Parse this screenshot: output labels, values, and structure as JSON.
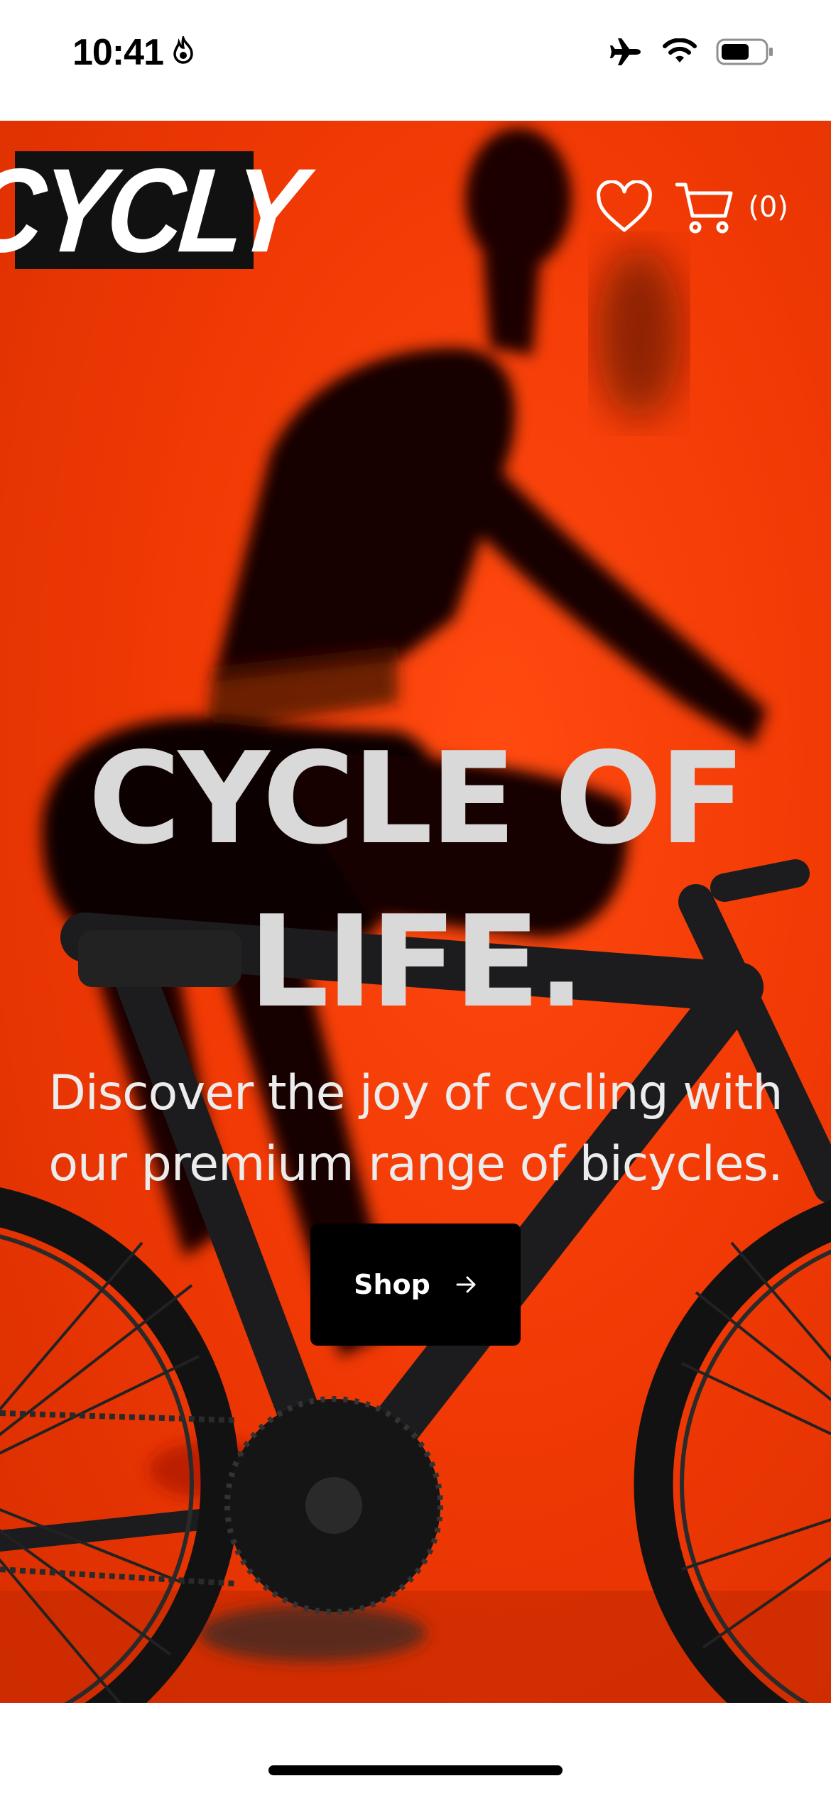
{
  "status_bar": {
    "time": "10:41",
    "icons": [
      "flame-icon",
      "airplane-icon",
      "wifi-icon",
      "battery-icon"
    ]
  },
  "header": {
    "logo_text": "CYCLY",
    "wishlist_icon": "heart-icon",
    "cart_icon": "cart-icon",
    "cart_count": "(0)"
  },
  "hero": {
    "headline_line1": "CYCLE OF",
    "headline_line2": "LIFE.",
    "subhead_line1": "Discover the joy of cycling with",
    "subhead_line2": "our premium range of bicycles.",
    "cta_label": "Shop",
    "cta_icon": "arrow-right-icon",
    "background_color": "#f23a05"
  }
}
